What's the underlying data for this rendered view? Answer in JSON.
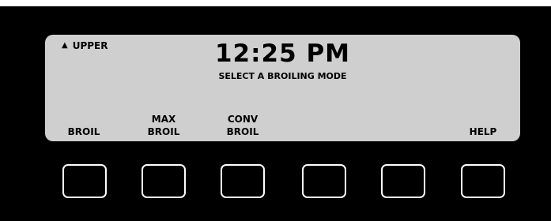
{
  "display": {
    "indicator_icon": "triangle-up-icon",
    "indicator": "UPPER",
    "time": "12:25 PM",
    "prompt": "SELECT A BROILING MODE"
  },
  "softkeys": [
    {
      "line1": "",
      "line2": "BROIL"
    },
    {
      "line1": "MAX",
      "line2": "BROIL"
    },
    {
      "line1": "CONV",
      "line2": "BROIL"
    },
    {
      "line1": "",
      "line2": ""
    },
    {
      "line1": "",
      "line2": ""
    },
    {
      "line1": "",
      "line2": "HELP"
    }
  ],
  "colors": {
    "panel": "#000000",
    "display": "#cfcfcf",
    "button_outline": "#ffffff"
  }
}
